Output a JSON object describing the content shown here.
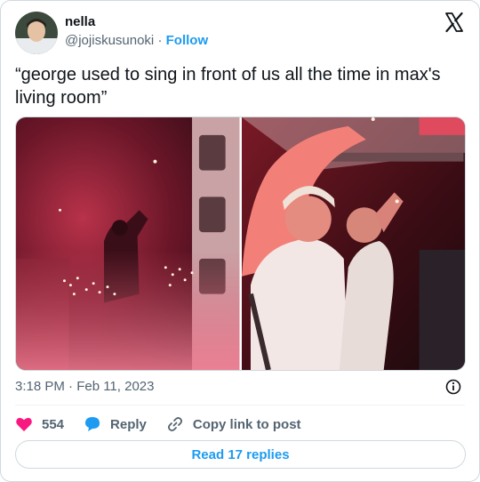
{
  "author": {
    "display_name": "nella",
    "handle": "@jojiskusunoki",
    "separator": "·",
    "follow_label": "Follow"
  },
  "tweet": {
    "text": "“george used to sing in front of us all the time in max's living room”",
    "timestamp": "3:18 PM · Feb 11, 2023"
  },
  "icons": {
    "brand": "x-logo-icon",
    "info": "info-icon",
    "like": "heart-icon",
    "reply": "speech-bubble-icon",
    "copy": "link-icon"
  },
  "actions": {
    "like_count": "554",
    "reply_label": "Reply",
    "copy_label": "Copy link to post"
  },
  "read_replies_label": "Read 17 replies",
  "colors": {
    "accent": "#1d9bf0",
    "like": "#f91880",
    "muted": "#536471",
    "text": "#0f1419"
  }
}
